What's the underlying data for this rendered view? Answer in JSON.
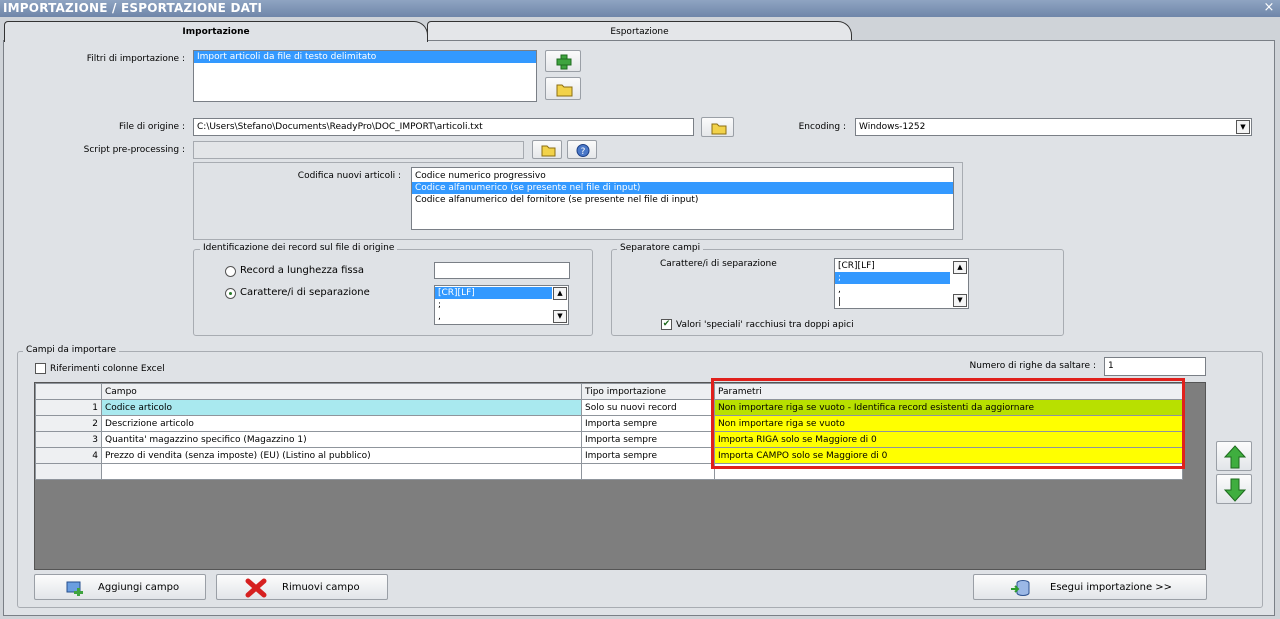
{
  "window": {
    "title": "IMPORTAZIONE / ESPORTAZIONE DATI",
    "close_glyph": "×"
  },
  "tabs": [
    {
      "label": "Importazione",
      "active": true
    },
    {
      "label": "Esportazione",
      "active": false
    }
  ],
  "filters": {
    "label": "Filtri di importazione :",
    "items": [
      "Import articoli da file di testo delimitato"
    ],
    "selected_index": 0,
    "add_icon": "green-plus-icon",
    "open_icon": "folder-icon"
  },
  "source_file": {
    "label": "File di origine :",
    "value": "C:\\Users\\Stefano\\Documents\\ReadyPro\\DOC_IMPORT\\articoli.txt"
  },
  "encoding": {
    "label": "Encoding :",
    "value": "Windows-1252"
  },
  "script": {
    "label": "Script pre-processing :",
    "value": ""
  },
  "coding": {
    "label": "Codifica nuovi articoli :",
    "items": [
      "Codice numerico progressivo",
      "Codice alfanumerico (se presente nel file di input)",
      "Codice alfanumerico del fornitore (se presente nel file di input)"
    ],
    "selected_index": 1
  },
  "record_id": {
    "legend": "Identificazione dei record sul file di origine",
    "option_fixed": "Record a lunghezza fissa",
    "option_sep": "Carattere/i di separazione",
    "fixed_value": "",
    "sep_items": [
      "[CR][LF]",
      ";",
      ","
    ],
    "sep_selected": 0
  },
  "field_sep": {
    "legend": "Separatore campi",
    "label": "Carattere/i di separazione",
    "items": [
      "[CR][LF]",
      ";",
      ",",
      "|"
    ],
    "selected_index": 1,
    "special_label": "Valori 'speciali' racchiusi tra doppi apici",
    "special_checked": true
  },
  "fields": {
    "legend": "Campi da importare",
    "excel_label": "Riferimenti colonne Excel",
    "skip_label": "Numero di righe da saltare :",
    "skip_value": "1",
    "columns": [
      "Campo",
      "Tipo importazione",
      "Parametri"
    ],
    "rows": [
      {
        "n": "1",
        "campo": "Codice articolo",
        "tipo": "Solo su nuovi record",
        "param": "Non importare riga se vuoto - Identifica record esistenti da aggiornare"
      },
      {
        "n": "2",
        "campo": "Descrizione articolo",
        "tipo": "Importa sempre",
        "param": "Non importare riga se vuoto"
      },
      {
        "n": "3",
        "campo": "Quantita' magazzino specifico (Magazzino 1)",
        "tipo": "Importa sempre",
        "param": "Importa RIGA solo se Maggiore di 0"
      },
      {
        "n": "4",
        "campo": "Prezzo di vendita (senza imposte) (EU) (Listino al pubblico)",
        "tipo": "Importa sempre",
        "param": "Importa CAMPO solo se Maggiore di 0"
      }
    ],
    "highlight_color": "#e0201c"
  },
  "buttons": {
    "add": "Aggiungi campo",
    "remove": "Rimuovi campo",
    "run": "Esegui importazione >>"
  }
}
